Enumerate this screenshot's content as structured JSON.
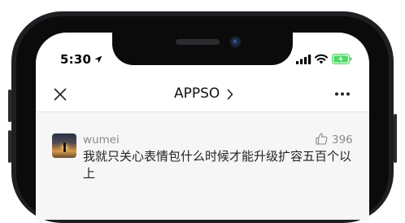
{
  "status_bar": {
    "time": "5:30"
  },
  "nav": {
    "title": "APPSO"
  },
  "comment": {
    "username": "wumei",
    "like_count": "396",
    "text": "我就只关心表情包什么时候才能升级扩容五百个以上"
  },
  "icons": {
    "location": "location-arrow-icon",
    "signal": "cellular-signal-icon",
    "wifi": "wifi-icon",
    "battery": "battery-charging-icon",
    "close": "close-icon",
    "chevron": "chevron-right-icon",
    "more": "more-dots-icon",
    "like": "thumbs-up-icon"
  },
  "colors": {
    "battery_green": "#4cd964",
    "phone_frame": "#1e1f22",
    "content_bg": "#f6f6f6",
    "meta_text": "#8a8a8a"
  }
}
